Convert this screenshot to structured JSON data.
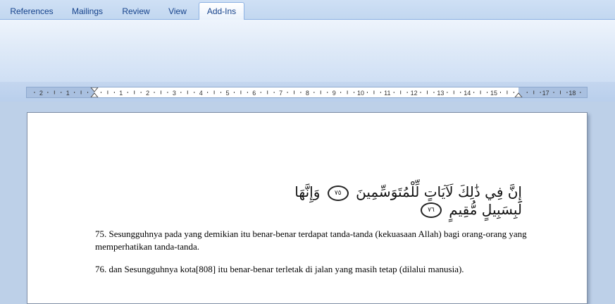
{
  "ribbon": {
    "tabs": [
      {
        "label": "References",
        "active": false
      },
      {
        "label": "Mailings",
        "active": false
      },
      {
        "label": "Review",
        "active": false
      },
      {
        "label": "View",
        "active": false
      },
      {
        "label": "Add-Ins",
        "active": true
      }
    ]
  },
  "ruler": {
    "left_ticks": [
      "2",
      "1"
    ],
    "right_ticks": [
      "1",
      "2",
      "3",
      "4",
      "5",
      "6",
      "7",
      "8",
      "9",
      "10",
      "11",
      "12",
      "13",
      "14",
      "15"
    ],
    "margin_ticks": [
      "17",
      "18"
    ]
  },
  "document": {
    "arabic_part1": "إِنَّ فِي ذَٰلِكَ لَآيَاتٍ لِّلْمُتَوَسِّمِينَ",
    "verse1": "٧٥",
    "arabic_part2": "وَإِنَّهَا لَبِسَبِيلٍ مُّقِيمٍ",
    "verse2": "٧٦",
    "translation_75": "75. Sesungguhnya pada yang demikian itu benar-benar terdapat tanda-tanda (kekuasaan Allah) bagi orang-orang yang memperhatikan tanda-tanda.",
    "translation_76": "76. dan Sesungguhnya kota[808] itu benar-benar terletak di jalan yang masih tetap (dilalui manusia)."
  },
  "colors": {
    "tab_text": "#15428b",
    "ribbon_border": "#8db2e3"
  }
}
